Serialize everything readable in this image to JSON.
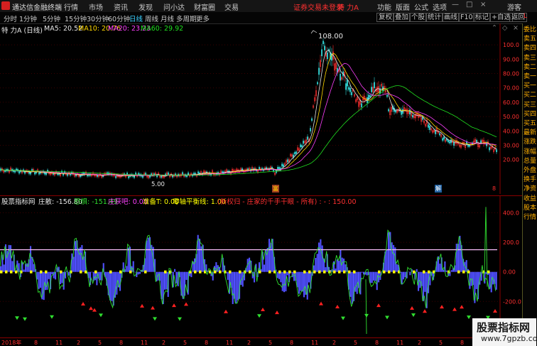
{
  "app": {
    "name": "通达信金融终端"
  },
  "menu": [
    "行情",
    "市场",
    "资讯",
    "发现",
    "问小达",
    "财富圈",
    "交易"
  ],
  "banner": {
    "notice": "证券交易未登录",
    "stock": "特 力A"
  },
  "right_menu": [
    "功能",
    "版面",
    "公式",
    "选项",
    "游客"
  ],
  "periods": [
    "分时",
    "1分钟",
    "5分钟",
    "15分钟",
    "30分钟",
    "60分钟",
    "日线",
    "周线",
    "月线",
    "多周期",
    "更多"
  ],
  "tools": [
    "复权",
    "叠加",
    "个股",
    "统计",
    "画线",
    "F10",
    "标记",
    "+自选",
    "返回"
  ],
  "chart_header": {
    "title": "特 力A (日线)",
    "ma": [
      {
        "label": "MA5: 20.52",
        "color": "#e8e8e8"
      },
      {
        "label": "MA10: 20.76",
        "color": "#ffd700"
      },
      {
        "label": "MA20: 23.23",
        "color": "#ff40ff"
      },
      {
        "label": "MA60: 29.92",
        "color": "#20e020"
      }
    ]
  },
  "price_axis": {
    "ticks": [
      "100.0",
      "90.00",
      "80.00",
      "70.00",
      "60.00",
      "50.00",
      "40.00",
      "30.00",
      "20.00"
    ]
  },
  "markers": {
    "high": "108.00",
    "low": "5.00",
    "left_tag": "富",
    "right_tag": "解",
    "scroll_tag": "8"
  },
  "indicator_header": {
    "name": "股票指标网",
    "items": [
      {
        "label": "庄散: -156.80",
        "color": "#e8e8e8"
      },
      {
        "label": "恐惧: -151.49",
        "color": "#30e030"
      },
      {
        "label": "庄获吧: 0.00",
        "color": "#ff40ff"
      },
      {
        "label": "准备T: 0.00",
        "color": "#ffff00"
      },
      {
        "label": "零轴平衡线: 1.00",
        "color": "#ffff00"
      },
      {
        "label": "(新权归 - 庄家的千手干眼 - 所有) : - : 150.00",
        "color": "#ff3030"
      }
    ]
  },
  "indicator_axis": {
    "ticks": [
      "400.0",
      "200.0",
      "0.00",
      "-200.0"
    ]
  },
  "date_axis": [
    "2018年",
    "8",
    "11",
    "2",
    "5",
    "8",
    "11",
    "2",
    "5",
    "8",
    "11",
    "2",
    "5",
    "8",
    "11",
    "2",
    "5",
    "8",
    "11",
    "2",
    "5",
    "8",
    "11"
  ],
  "sidebar": {
    "top": "L",
    "items": [
      "委比",
      "卖五",
      "卖四",
      "卖三",
      "卖二",
      "卖一",
      "买一",
      "买二",
      "买三",
      "买四",
      "买五",
      "最新",
      "涨跌",
      "涨幅",
      "总量",
      "外盘",
      "换手",
      "净资",
      "收益",
      "股本",
      "行情"
    ]
  },
  "watermark": {
    "line1": "股票指标网",
    "line2": "www.7gpzb.com"
  },
  "colors": {
    "up": "#ff3030",
    "down": "#30d0d0",
    "ma60": "#20e020",
    "accent": "#ff2020",
    "gold": "#ffb000",
    "blue_bar": "#5050ff"
  }
}
